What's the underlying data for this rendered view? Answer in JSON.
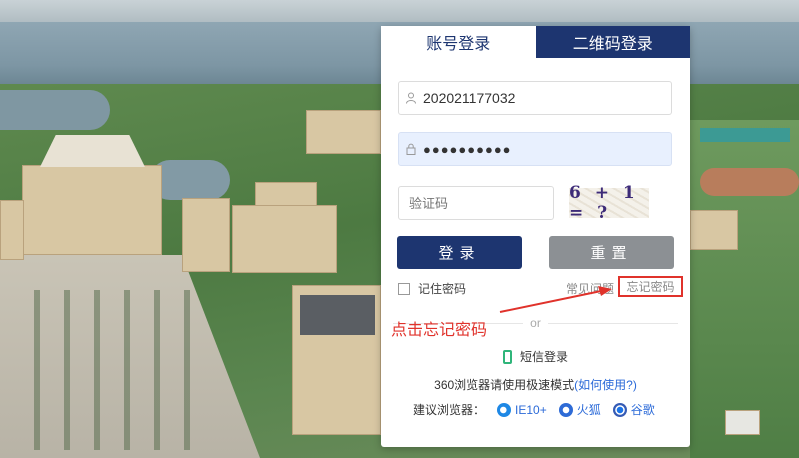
{
  "tabs": {
    "account_login": "账号登录",
    "qr_login": "二维码登录"
  },
  "form": {
    "username": "202021177032",
    "password_mask": "●●●●●●●●●●",
    "captcha_placeholder": "验证码",
    "captcha_text": "6 + 1 = ?",
    "login_button": "登录",
    "reset_button": "重置",
    "remember_label": "记住密码",
    "faq_link": "常见问题",
    "forgot_link": "忘记密码"
  },
  "divider": {
    "or": "or"
  },
  "sms": {
    "label": "短信登录"
  },
  "browser_tip": {
    "text": "360浏览器请使用极速模式",
    "link": "(如何使用?)"
  },
  "browsers": {
    "label": "建议浏览器：",
    "items": [
      "IE10+",
      "火狐",
      "谷歌"
    ]
  },
  "annotation": {
    "text": "点击忘记密码",
    "color": "#e0322b"
  },
  "colors": {
    "primary": "#1d3570",
    "reset": "#8c9094",
    "link": "#2b6ad8",
    "sms_icon": "#2fb57a"
  }
}
